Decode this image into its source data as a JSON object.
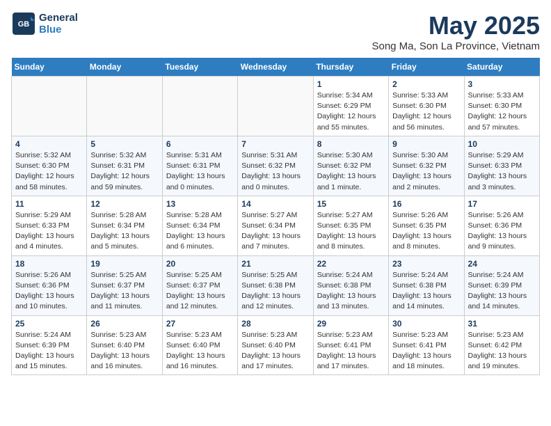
{
  "header": {
    "logo_line1": "General",
    "logo_line2": "Blue",
    "month_title": "May 2025",
    "location": "Song Ma, Son La Province, Vietnam"
  },
  "days_of_week": [
    "Sunday",
    "Monday",
    "Tuesday",
    "Wednesday",
    "Thursday",
    "Friday",
    "Saturday"
  ],
  "weeks": [
    [
      {
        "day": "",
        "info": ""
      },
      {
        "day": "",
        "info": ""
      },
      {
        "day": "",
        "info": ""
      },
      {
        "day": "",
        "info": ""
      },
      {
        "day": "1",
        "info": "Sunrise: 5:34 AM\nSunset: 6:29 PM\nDaylight: 12 hours\nand 55 minutes."
      },
      {
        "day": "2",
        "info": "Sunrise: 5:33 AM\nSunset: 6:30 PM\nDaylight: 12 hours\nand 56 minutes."
      },
      {
        "day": "3",
        "info": "Sunrise: 5:33 AM\nSunset: 6:30 PM\nDaylight: 12 hours\nand 57 minutes."
      }
    ],
    [
      {
        "day": "4",
        "info": "Sunrise: 5:32 AM\nSunset: 6:30 PM\nDaylight: 12 hours\nand 58 minutes."
      },
      {
        "day": "5",
        "info": "Sunrise: 5:32 AM\nSunset: 6:31 PM\nDaylight: 12 hours\nand 59 minutes."
      },
      {
        "day": "6",
        "info": "Sunrise: 5:31 AM\nSunset: 6:31 PM\nDaylight: 13 hours\nand 0 minutes."
      },
      {
        "day": "7",
        "info": "Sunrise: 5:31 AM\nSunset: 6:32 PM\nDaylight: 13 hours\nand 0 minutes."
      },
      {
        "day": "8",
        "info": "Sunrise: 5:30 AM\nSunset: 6:32 PM\nDaylight: 13 hours\nand 1 minute."
      },
      {
        "day": "9",
        "info": "Sunrise: 5:30 AM\nSunset: 6:32 PM\nDaylight: 13 hours\nand 2 minutes."
      },
      {
        "day": "10",
        "info": "Sunrise: 5:29 AM\nSunset: 6:33 PM\nDaylight: 13 hours\nand 3 minutes."
      }
    ],
    [
      {
        "day": "11",
        "info": "Sunrise: 5:29 AM\nSunset: 6:33 PM\nDaylight: 13 hours\nand 4 minutes."
      },
      {
        "day": "12",
        "info": "Sunrise: 5:28 AM\nSunset: 6:34 PM\nDaylight: 13 hours\nand 5 minutes."
      },
      {
        "day": "13",
        "info": "Sunrise: 5:28 AM\nSunset: 6:34 PM\nDaylight: 13 hours\nand 6 minutes."
      },
      {
        "day": "14",
        "info": "Sunrise: 5:27 AM\nSunset: 6:34 PM\nDaylight: 13 hours\nand 7 minutes."
      },
      {
        "day": "15",
        "info": "Sunrise: 5:27 AM\nSunset: 6:35 PM\nDaylight: 13 hours\nand 8 minutes."
      },
      {
        "day": "16",
        "info": "Sunrise: 5:26 AM\nSunset: 6:35 PM\nDaylight: 13 hours\nand 8 minutes."
      },
      {
        "day": "17",
        "info": "Sunrise: 5:26 AM\nSunset: 6:36 PM\nDaylight: 13 hours\nand 9 minutes."
      }
    ],
    [
      {
        "day": "18",
        "info": "Sunrise: 5:26 AM\nSunset: 6:36 PM\nDaylight: 13 hours\nand 10 minutes."
      },
      {
        "day": "19",
        "info": "Sunrise: 5:25 AM\nSunset: 6:37 PM\nDaylight: 13 hours\nand 11 minutes."
      },
      {
        "day": "20",
        "info": "Sunrise: 5:25 AM\nSunset: 6:37 PM\nDaylight: 13 hours\nand 12 minutes."
      },
      {
        "day": "21",
        "info": "Sunrise: 5:25 AM\nSunset: 6:38 PM\nDaylight: 13 hours\nand 12 minutes."
      },
      {
        "day": "22",
        "info": "Sunrise: 5:24 AM\nSunset: 6:38 PM\nDaylight: 13 hours\nand 13 minutes."
      },
      {
        "day": "23",
        "info": "Sunrise: 5:24 AM\nSunset: 6:38 PM\nDaylight: 13 hours\nand 14 minutes."
      },
      {
        "day": "24",
        "info": "Sunrise: 5:24 AM\nSunset: 6:39 PM\nDaylight: 13 hours\nand 14 minutes."
      }
    ],
    [
      {
        "day": "25",
        "info": "Sunrise: 5:24 AM\nSunset: 6:39 PM\nDaylight: 13 hours\nand 15 minutes."
      },
      {
        "day": "26",
        "info": "Sunrise: 5:23 AM\nSunset: 6:40 PM\nDaylight: 13 hours\nand 16 minutes."
      },
      {
        "day": "27",
        "info": "Sunrise: 5:23 AM\nSunset: 6:40 PM\nDaylight: 13 hours\nand 16 minutes."
      },
      {
        "day": "28",
        "info": "Sunrise: 5:23 AM\nSunset: 6:40 PM\nDaylight: 13 hours\nand 17 minutes."
      },
      {
        "day": "29",
        "info": "Sunrise: 5:23 AM\nSunset: 6:41 PM\nDaylight: 13 hours\nand 17 minutes."
      },
      {
        "day": "30",
        "info": "Sunrise: 5:23 AM\nSunset: 6:41 PM\nDaylight: 13 hours\nand 18 minutes."
      },
      {
        "day": "31",
        "info": "Sunrise: 5:23 AM\nSunset: 6:42 PM\nDaylight: 13 hours\nand 19 minutes."
      }
    ]
  ]
}
